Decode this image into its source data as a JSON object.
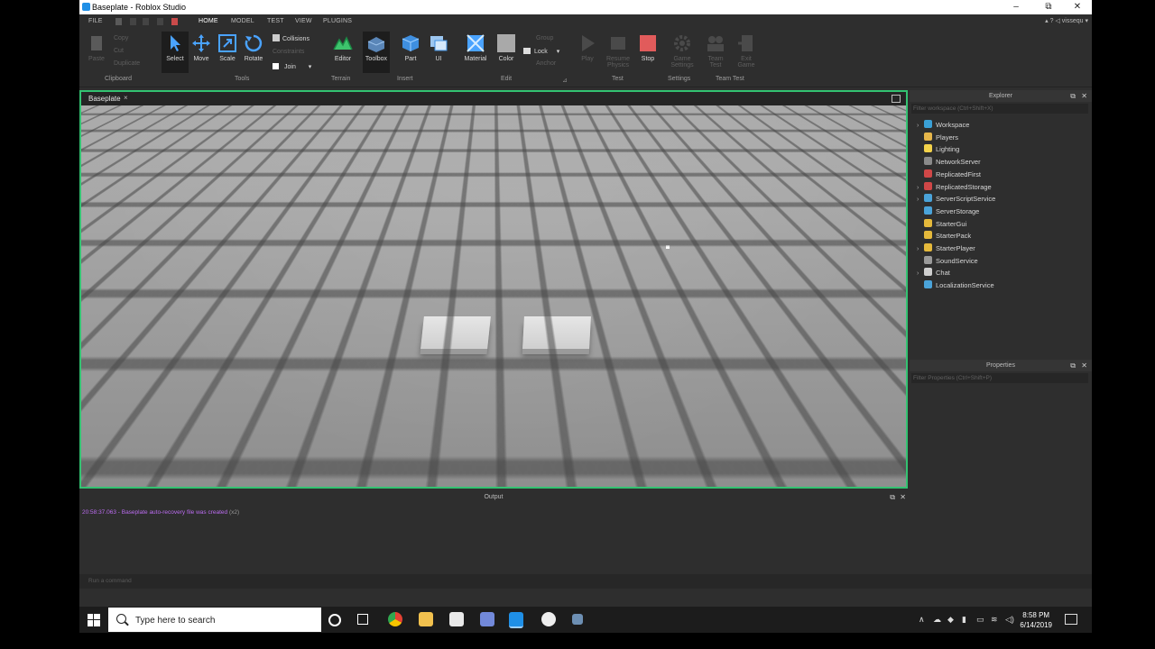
{
  "window": {
    "title": "Baseplate - Roblox Studio",
    "controls": [
      "–",
      "⧉",
      "✕"
    ]
  },
  "menu": {
    "items": [
      "FILE",
      "HOME",
      "MODEL",
      "TEST",
      "VIEW",
      "PLUGINS"
    ],
    "active": "HOME",
    "user": "vissequ"
  },
  "ribbon": {
    "clipboard": {
      "paste": "Paste",
      "copy": "Copy",
      "cut": "Cut",
      "duplicate": "Duplicate",
      "group": "Clipboard"
    },
    "tools": {
      "select": "Select",
      "move": "Move",
      "scale": "Scale",
      "rotate": "Rotate",
      "collisions": "Collisions",
      "constraints": "Constraints",
      "join": "Join",
      "group": "Tools"
    },
    "terrain": {
      "editor": "Editor",
      "group": "Terrain"
    },
    "insert": {
      "toolbox": "Toolbox",
      "part": "Part",
      "ui": "UI",
      "group": "Insert"
    },
    "edit": {
      "material": "Material",
      "color": "Color",
      "group_btn": "Group",
      "lock": "Lock",
      "anchor": "Anchor",
      "group": "Edit"
    },
    "test": {
      "play": "Play",
      "resume": "Resume Physics",
      "stop": "Stop",
      "group": "Test"
    },
    "settings": {
      "game_settings": "Game Settings",
      "group": "Settings"
    },
    "team_test": {
      "team_test": "Team Test",
      "exit_game": "Exit Game",
      "group": "Team Test"
    }
  },
  "viewport": {
    "tab": "Baseplate",
    "close": "×"
  },
  "explorer": {
    "title": "Explorer",
    "filter_placeholder": "Filter workspace (Ctrl+Shift+X)",
    "items": [
      {
        "name": "Workspace",
        "expandable": true,
        "color": "#3aa0d6"
      },
      {
        "name": "Players",
        "expandable": false,
        "color": "#e6b64a"
      },
      {
        "name": "Lighting",
        "expandable": false,
        "color": "#f3d24a"
      },
      {
        "name": "NetworkServer",
        "expandable": false,
        "color": "#8a8a8a"
      },
      {
        "name": "ReplicatedFirst",
        "expandable": false,
        "color": "#d04747"
      },
      {
        "name": "ReplicatedStorage",
        "expandable": true,
        "color": "#d04747"
      },
      {
        "name": "ServerScriptService",
        "expandable": true,
        "color": "#4aa3d9"
      },
      {
        "name": "ServerStorage",
        "expandable": false,
        "color": "#4aa3d9"
      },
      {
        "name": "StarterGui",
        "expandable": false,
        "color": "#e5b93b"
      },
      {
        "name": "StarterPack",
        "expandable": false,
        "color": "#e5b93b"
      },
      {
        "name": "StarterPlayer",
        "expandable": true,
        "color": "#e5b93b"
      },
      {
        "name": "SoundService",
        "expandable": false,
        "color": "#9a9a9a"
      },
      {
        "name": "Chat",
        "expandable": true,
        "color": "#cfcfcf"
      },
      {
        "name": "LocalizationService",
        "expandable": false,
        "color": "#4aa3d9"
      }
    ]
  },
  "properties": {
    "title": "Properties",
    "filter_placeholder": "Filter Properties (Ctrl+Shift+P)"
  },
  "output": {
    "title": "Output",
    "log_text": "20:58:37.063 - Baseplate auto-recovery file was created",
    "log_count": "(x2)",
    "command_placeholder": "Run a command"
  },
  "taskbar": {
    "search_placeholder": "Type here to search",
    "time": "8:58 PM",
    "date": "6/14/2019"
  }
}
